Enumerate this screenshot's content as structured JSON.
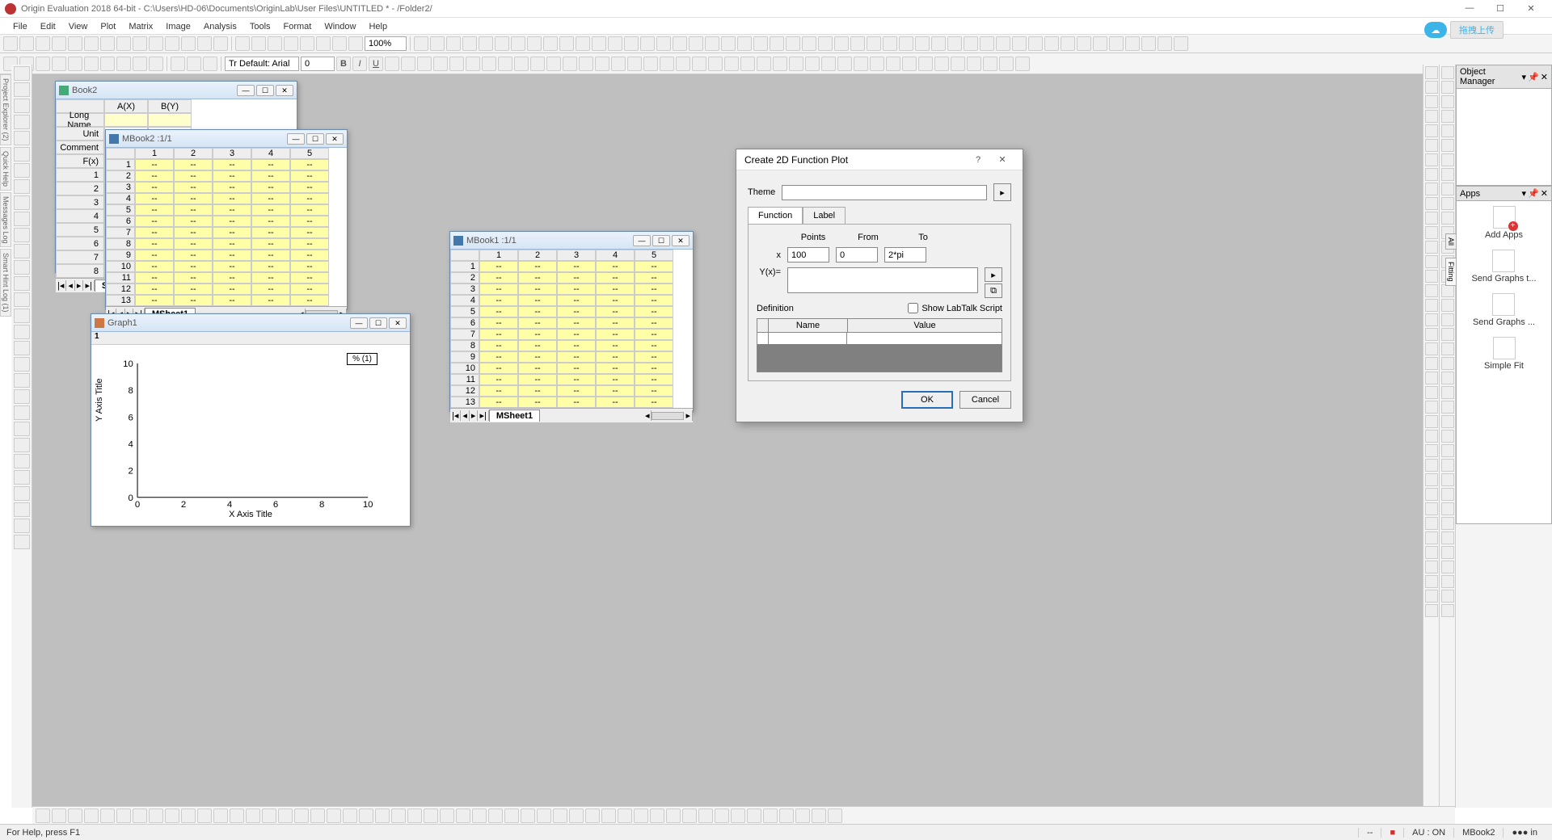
{
  "app": {
    "title": "Origin Evaluation 2018 64-bit - C:\\Users\\HD-06\\Documents\\OriginLab\\User Files\\UNTITLED * - /Folder2/",
    "cloud_text": "拖拽上传"
  },
  "menu": [
    "File",
    "Edit",
    "View",
    "Plot",
    "Matrix",
    "Image",
    "Analysis",
    "Tools",
    "Format",
    "Window",
    "Help"
  ],
  "toolbar": {
    "zoom": "100%",
    "font": "Tr Default: Arial",
    "fontsize": "0"
  },
  "windows": {
    "book2": {
      "title": "Book2",
      "col_a": "A(X)",
      "col_b": "B(Y)",
      "rows": [
        "Long Name",
        "Unit",
        "Comment",
        "F(x)"
      ]
    },
    "mbook2": {
      "title": "MBook2 :1/1",
      "cols": [
        "1",
        "2",
        "3",
        "4",
        "5"
      ],
      "rows": 14,
      "sheet": "MSheet1"
    },
    "mbook1": {
      "title": "MBook1 :1/1",
      "cols": [
        "1",
        "2",
        "3",
        "4",
        "5"
      ],
      "rows": 14,
      "sheet": "MSheet1"
    },
    "graph1": {
      "title": "Graph1",
      "layer": "1",
      "legend": "% (1)",
      "x_title": "X Axis Title",
      "y_title": "Y Axis Title",
      "y_ticks": [
        "10",
        "8",
        "6",
        "4",
        "2",
        "0"
      ],
      "x_ticks": [
        "0",
        "2",
        "4",
        "6",
        "8",
        "10"
      ]
    }
  },
  "dialog": {
    "title": "Create 2D Function Plot",
    "theme_lbl": "Theme",
    "theme_val": "",
    "tabs": [
      "Function",
      "Label"
    ],
    "points_lbl": "Points",
    "from_lbl": "From",
    "to_lbl": "To",
    "x_lbl": "x",
    "points": "100",
    "from": "0",
    "to": "2*pi",
    "yx_lbl": "Y(x)=",
    "yx_val": "",
    "def_lbl": "Definition",
    "show_lt": "Show LabTalk Script",
    "th_name": "Name",
    "th_value": "Value",
    "ok": "OK",
    "cancel": "Cancel"
  },
  "right": {
    "obj_mgr": "Object Manager",
    "apps_hdr": "Apps",
    "apps": [
      "Add Apps",
      "Send Graphs t...",
      "Send Graphs ...",
      "Simple Fit"
    ],
    "side_tabs": [
      "All",
      "Fitting"
    ]
  },
  "left_tabs": [
    "Project Explorer (2)",
    "Quick Help",
    "Messages Log",
    "Smart Hint Log (1)"
  ],
  "status": {
    "help": "For Help, press F1",
    "au": "AU : ON",
    "book": "MBook2",
    "dash": "--"
  },
  "chart_data": {
    "type": "line",
    "title": "",
    "xlabel": "X Axis Title",
    "ylabel": "Y Axis Title",
    "xlim": [
      0,
      10
    ],
    "ylim": [
      0,
      10
    ],
    "x_ticks": [
      0,
      2,
      4,
      6,
      8,
      10
    ],
    "y_ticks": [
      0,
      2,
      4,
      6,
      8,
      10
    ],
    "series": [
      {
        "name": "% (1)",
        "x": [],
        "y": []
      }
    ]
  }
}
